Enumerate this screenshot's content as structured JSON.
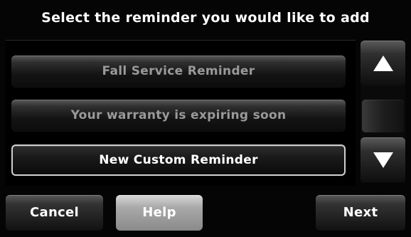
{
  "header": {
    "title": "Select the reminder you would like to add"
  },
  "reminders": [
    {
      "label": "Fall Service Reminder",
      "selected": false
    },
    {
      "label": "Your warranty is expiring soon",
      "selected": false
    },
    {
      "label": "New Custom Reminder",
      "selected": true
    }
  ],
  "scroll": {
    "up_icon": "triangle-up",
    "down_icon": "triangle-down"
  },
  "footer": {
    "cancel_label": "Cancel",
    "help_label": "Help",
    "next_label": "Next"
  },
  "colors": {
    "background": "#000000",
    "text_selected": "#ffffff",
    "text_unselected": "#9a9a9a",
    "help_button": "#b0b0b0"
  }
}
